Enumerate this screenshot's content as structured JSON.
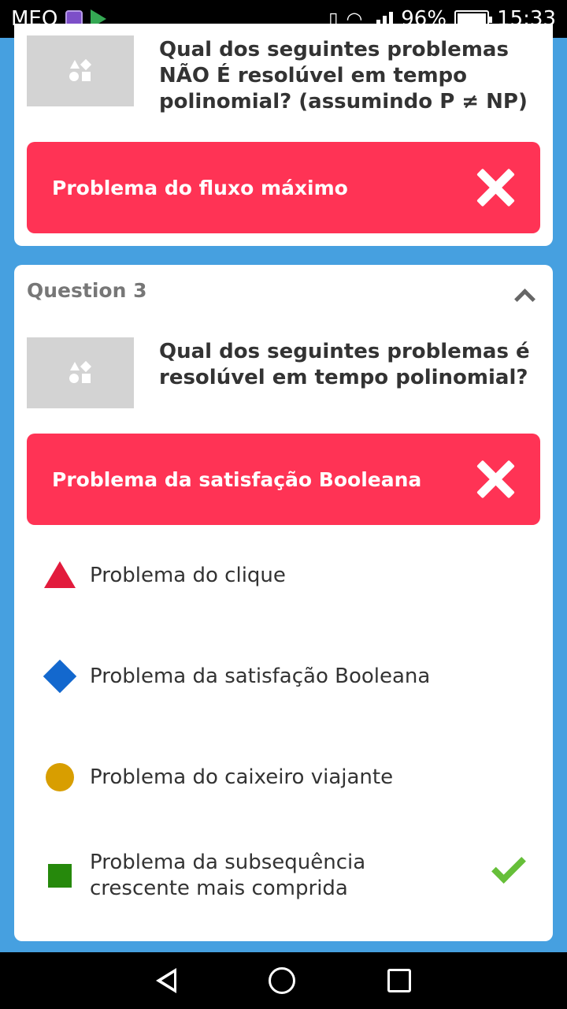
{
  "status_bar": {
    "carrier": "MEO",
    "battery": "96%",
    "time": "15:33"
  },
  "previous_question": {
    "text": "Qual dos seguintes problemas NÃO É resolúvel em tempo polinomial? (assumindo P ≠ NP)",
    "given_answer": "Problema do fluxo máximo"
  },
  "question3": {
    "label": "Question 3",
    "text": "Qual dos seguintes problemas é resolúvel em tempo polinomial?",
    "given_answer": "Problema da satisfação Booleana",
    "options": [
      {
        "shape": "triangle",
        "color": "#e21b3c",
        "text": "Problema do clique",
        "correct": false
      },
      {
        "shape": "diamond",
        "color": "#1368ce",
        "text": "Problema da satisfação Booleana",
        "correct": false
      },
      {
        "shape": "circle",
        "color": "#d89e00",
        "text": "Problema do caixeiro viajante",
        "correct": false
      },
      {
        "shape": "square",
        "color": "#26890c",
        "text": "Problema da subsequência crescente mais comprida",
        "correct": true
      }
    ]
  },
  "colors": {
    "background": "#46a0e0",
    "wrong_answer": "#ff3355",
    "correct_check": "#66bf39"
  }
}
